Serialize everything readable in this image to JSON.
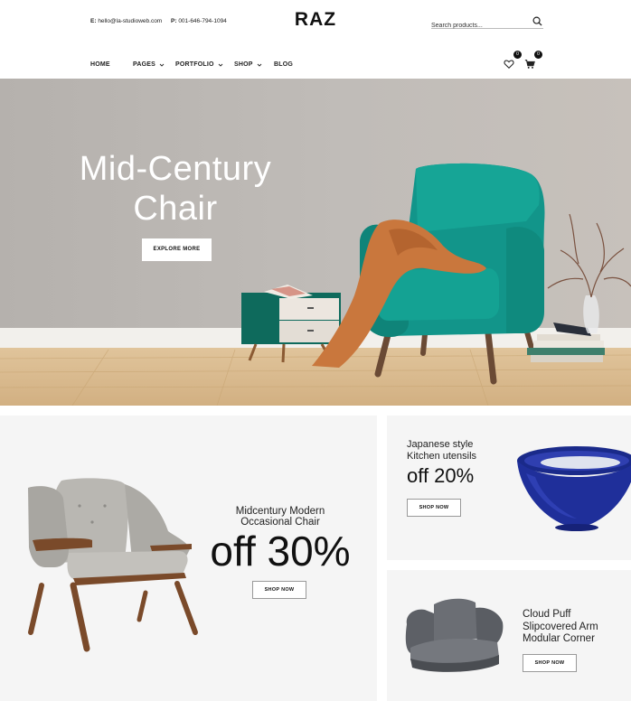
{
  "header": {
    "email_label": "E:",
    "email": "hello@la-studioweb.com",
    "phone_label": "P:",
    "phone": "001-646-794-1094",
    "logo": "RAZ",
    "search_placeholder": "Search products..."
  },
  "nav": {
    "items": [
      {
        "label": "HOME",
        "has_dropdown": false
      },
      {
        "label": "PAGES",
        "has_dropdown": true
      },
      {
        "label": "PORTFOLIO",
        "has_dropdown": true
      },
      {
        "label": "SHOP",
        "has_dropdown": true
      },
      {
        "label": "BLOG",
        "has_dropdown": false
      }
    ],
    "wishlist_count": "0",
    "cart_count": "0"
  },
  "hero": {
    "title_line1": "Mid-Century",
    "title_line2": "Chair",
    "button": "EXPLORE MORE"
  },
  "promos": {
    "left": {
      "subtitle_line1": "Midcentury Modern",
      "subtitle_line2": "Occasional Chair",
      "discount": "off 30%",
      "button": "SHOP NOW"
    },
    "right_top": {
      "subtitle_line1": "Japanese style",
      "subtitle_line2": "Kitchen utensils",
      "discount": "off 20%",
      "button": "SHOP NOW"
    },
    "right_bottom": {
      "title_line1": "Cloud Puff",
      "title_line2": "Slipcovered Arm",
      "title_line3": "Modular Corner",
      "button": "SHOP NOW"
    }
  },
  "colors": {
    "teal_chair": "#12958a",
    "wall": "#bcb8b3",
    "floor": "#d8b98c",
    "panel_bg": "#f5f5f5",
    "bowl_blue": "#1f2f9a"
  }
}
